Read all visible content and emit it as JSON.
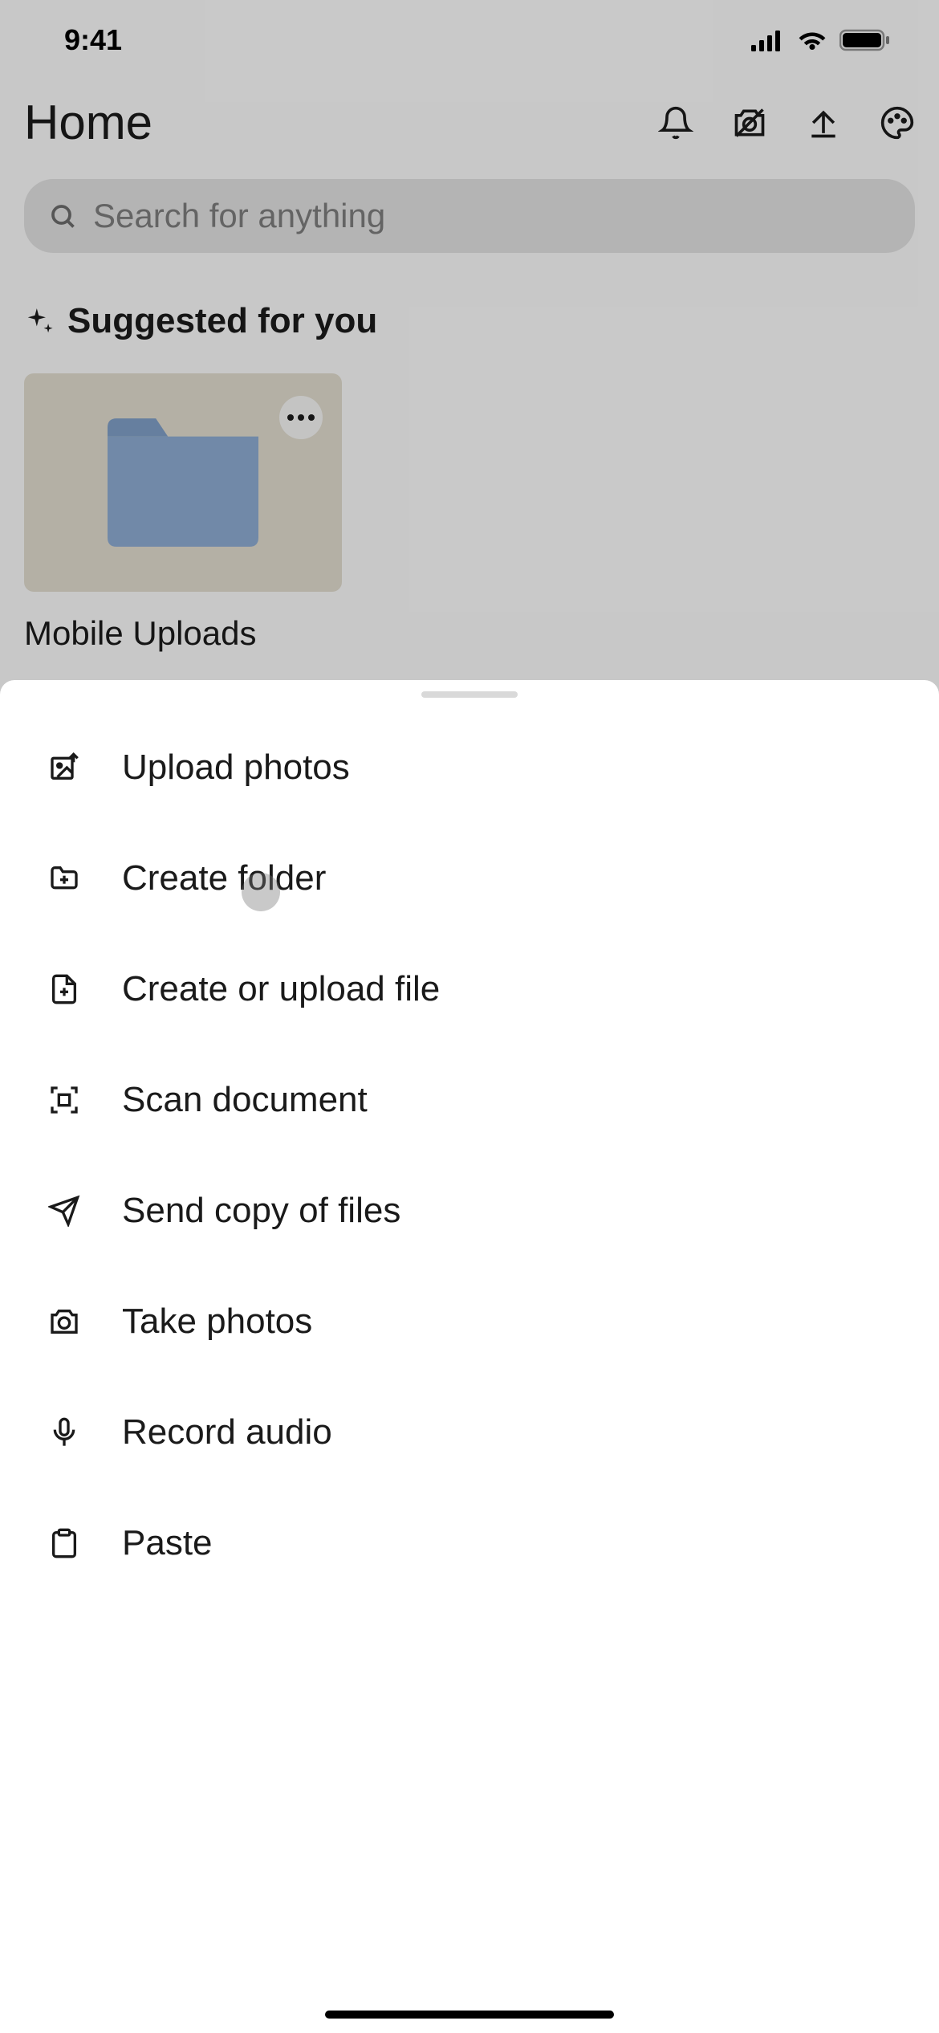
{
  "statusBar": {
    "time": "9:41"
  },
  "header": {
    "title": "Home"
  },
  "search": {
    "placeholder": "Search for anything"
  },
  "suggested": {
    "title": "Suggested for you",
    "folderLabel": "Mobile Uploads"
  },
  "sheet": {
    "items": [
      {
        "icon": "upload-photos-icon",
        "label": "Upload photos"
      },
      {
        "icon": "create-folder-icon",
        "label": "Create folder"
      },
      {
        "icon": "create-upload-file-icon",
        "label": "Create or upload file"
      },
      {
        "icon": "scan-document-icon",
        "label": "Scan document"
      },
      {
        "icon": "send-copy-icon",
        "label": "Send copy of files"
      },
      {
        "icon": "take-photos-icon",
        "label": "Take photos"
      },
      {
        "icon": "record-audio-icon",
        "label": "Record audio"
      },
      {
        "icon": "paste-icon",
        "label": "Paste"
      }
    ]
  }
}
